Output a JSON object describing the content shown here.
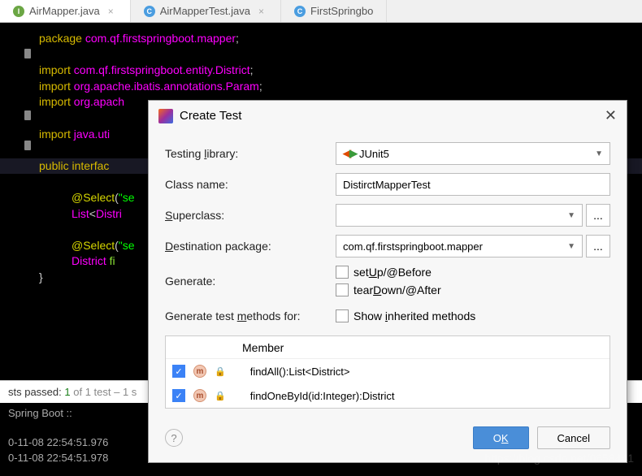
{
  "tabs": [
    {
      "icon": "i",
      "label": "AirMapper.java",
      "active": true
    },
    {
      "icon": "c",
      "label": "AirMapperTest.java",
      "active": false
    },
    {
      "icon": "c",
      "label": "FirstSpringbo",
      "active": false,
      "truncated": true
    }
  ],
  "code": {
    "package_kw": "package",
    "package_name": "com.qf.firstspringboot.mapper",
    "import_kw": "import",
    "imports": [
      "com.qf.firstspringboot.entity.District",
      "org.apache.ibatis.annotations.Param",
      "org.apach"
    ],
    "import_java": "java.uti",
    "public_line": "public interfac",
    "select_ann": "@Select",
    "str_se": "\"se",
    "list_line": "List<Distri",
    "district_line": "District fi",
    "brace": "}"
  },
  "dialog": {
    "title": "Create Test",
    "labels": {
      "testing_library": "Testing library:",
      "class_name": "Class name:",
      "superclass": "Superclass:",
      "destination": "Destination package:",
      "generate": "Generate:",
      "methods_for": "Generate test methods for:",
      "member": "Member"
    },
    "values": {
      "library": "JUnit5",
      "class_name": "DistirctMapperTest",
      "superclass": "",
      "destination": "com.qf.firstspringboot.mapper"
    },
    "checkboxes": {
      "setup": "setUp/@Before",
      "teardown": "tearDown/@After",
      "inherited": "Show inherited methods"
    },
    "methods": [
      {
        "name": "findAll():List<District>",
        "checked": true
      },
      {
        "name": "findOneById(id:Integer):District",
        "checked": true
      }
    ],
    "buttons": {
      "ok": "OK",
      "cancel": "Cancel"
    }
  },
  "testresult": {
    "prefix": "sts passed:",
    "count": "1",
    "of": "of 1 test – 1 s"
  },
  "console": {
    "line1": "Spring Boot ::",
    "line2": "0-11-08 22:54:51.976",
    "line3": "0-11-08 22:54:51.978"
  },
  "watermark": "https://blog.csdn.net/0658441"
}
